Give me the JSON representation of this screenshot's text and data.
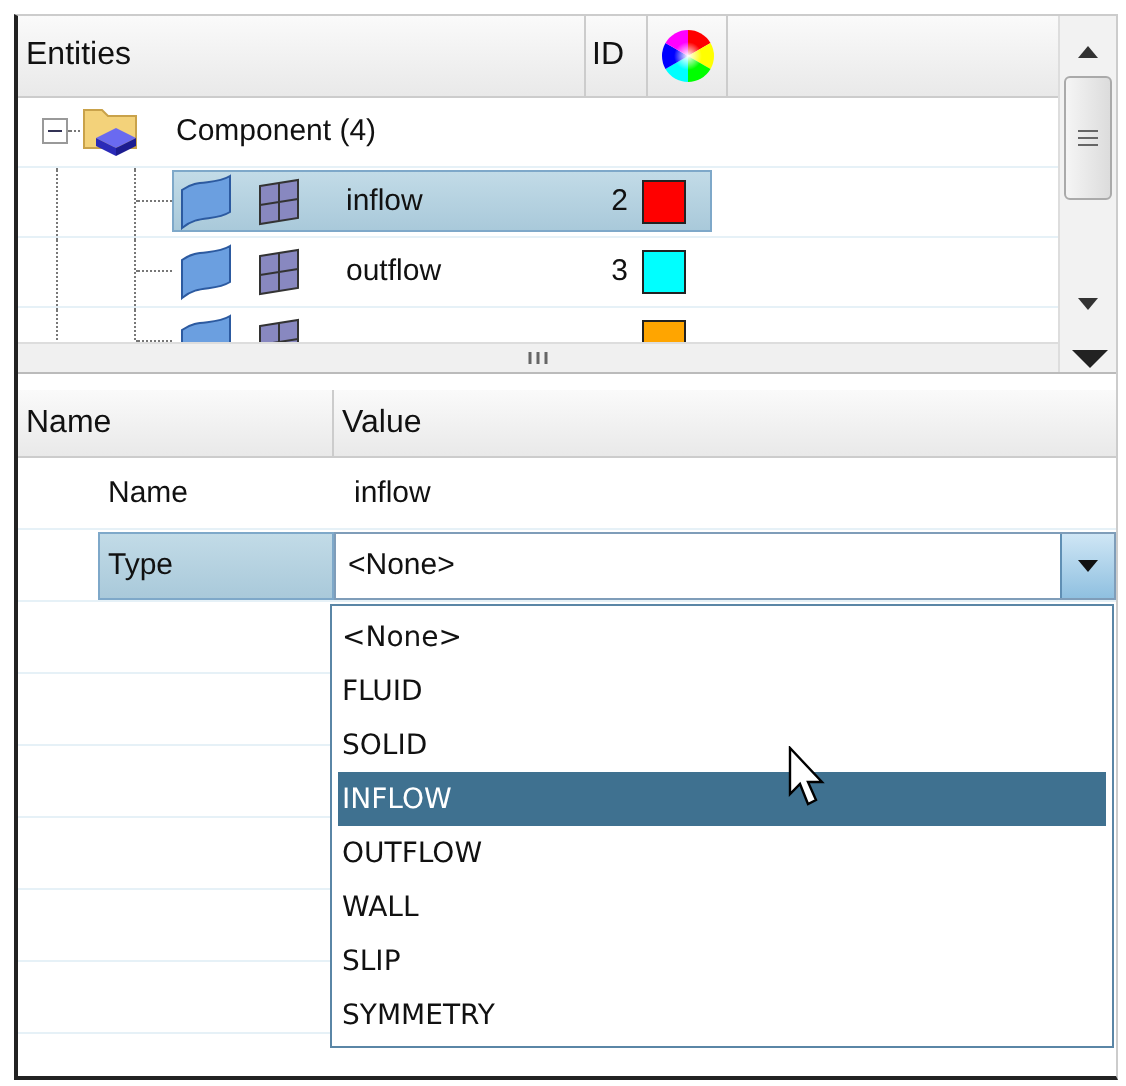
{
  "tree": {
    "columns": [
      "Entities",
      "ID"
    ],
    "root": {
      "label": "Component (4)",
      "expanded": true,
      "children": [
        {
          "name": "inflow",
          "id": "2",
          "color": "#ff0000",
          "selected": true
        },
        {
          "name": "outflow",
          "id": "3",
          "color": "#00ffff",
          "selected": false
        },
        {
          "color": "#ffa500",
          "selected": false
        }
      ]
    }
  },
  "properties": {
    "columns": [
      "Name",
      "Value"
    ],
    "rows": [
      {
        "kind": "text",
        "name": "Name",
        "value": "inflow",
        "selected": false
      },
      {
        "kind": "dropdown",
        "name": "Type",
        "value": "<None>",
        "selected": true,
        "expanded": true,
        "options": [
          {
            "label": "<None>",
            "highlighted": false
          },
          {
            "label": "FLUID",
            "highlighted": false
          },
          {
            "label": "SOLID",
            "highlighted": false
          },
          {
            "label": "INFLOW",
            "highlighted": true
          },
          {
            "label": "OUTFLOW",
            "highlighted": false
          },
          {
            "label": "WALL",
            "highlighted": false
          },
          {
            "label": "SLIP",
            "highlighted": false
          },
          {
            "label": "SYMMETRY",
            "highlighted": false
          }
        ]
      }
    ]
  }
}
